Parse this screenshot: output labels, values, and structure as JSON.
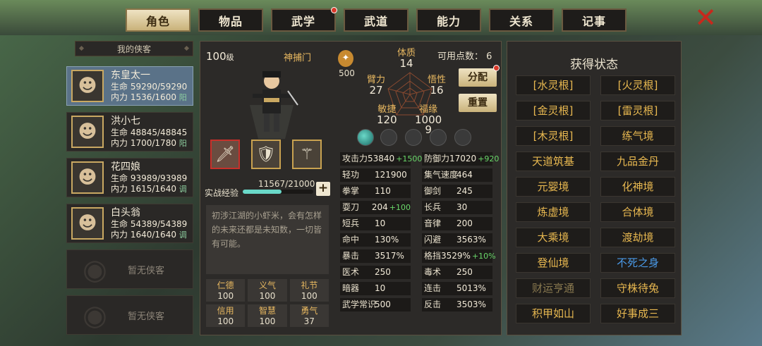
{
  "tabs": [
    {
      "label": "角色",
      "active": true
    },
    {
      "label": "物品"
    },
    {
      "label": "武学",
      "badge": true
    },
    {
      "label": "武道"
    },
    {
      "label": "能力"
    },
    {
      "label": "关系"
    },
    {
      "label": "记事"
    }
  ],
  "list": {
    "header": "我的侠客",
    "heroes": [
      {
        "name": "东皇太一",
        "hp_label": "生命",
        "hp": "59290/59290",
        "mp_label": "内力",
        "mp": "1536/1600",
        "tag": "阳",
        "selected": true
      },
      {
        "name": "洪小七",
        "hp_label": "生命",
        "hp": "48845/48845",
        "mp_label": "内力",
        "mp": "1700/1780",
        "tag": "阳"
      },
      {
        "name": "花四娘",
        "hp_label": "生命",
        "hp": "93989/93989",
        "mp_label": "内力",
        "mp": "1615/1640",
        "tag": "调"
      },
      {
        "name": "白头翁",
        "hp_label": "生命",
        "hp": "54389/54389",
        "mp_label": "内力",
        "mp": "1640/1640",
        "tag": "调"
      }
    ],
    "empty_label": "暂无侠客"
  },
  "char": {
    "level": "100",
    "level_unit": "级",
    "sect": "神捕门",
    "medal_value": "500",
    "exp_label": "实战经验",
    "exp_value": "11567/21000",
    "exp_fraction": 0.55,
    "bio": "初涉江湖的小虾米，会有怎样的未来还都是未知数，一切皆有可能。",
    "virtues": [
      {
        "l": "仁德",
        "v": "100"
      },
      {
        "l": "义气",
        "v": "100"
      },
      {
        "l": "礼节",
        "v": "100"
      },
      {
        "l": "信用",
        "v": "100"
      },
      {
        "l": "智慧",
        "v": "100"
      },
      {
        "l": "勇气",
        "v": "37"
      }
    ]
  },
  "radar": {
    "tizhi": {
      "l": "体质",
      "v": "14"
    },
    "bili": {
      "l": "臂力",
      "v": "27"
    },
    "wuxing": {
      "l": "悟性",
      "v": "16"
    },
    "minjie": {
      "l": "敏捷",
      "v": "120"
    },
    "fuyuan": {
      "l": "福缘",
      "v": "1000\n9"
    }
  },
  "points": {
    "label": "可用点数：",
    "value": "6",
    "assign": "分配",
    "reset": "重置"
  },
  "stats": [
    {
      "k": "攻击力",
      "v": "53840",
      "b": "+1500"
    },
    {
      "k": "防御力",
      "v": "17020",
      "b": "+920"
    },
    {
      "k": "轻功",
      "v": "121900"
    },
    {
      "k": "集气速度",
      "v": "464"
    },
    {
      "k": "拳掌",
      "v": "110"
    },
    {
      "k": "御剑",
      "v": "245"
    },
    {
      "k": "耍刀",
      "v": "204",
      "b": "+100"
    },
    {
      "k": "长兵",
      "v": "30"
    },
    {
      "k": "短兵",
      "v": "10"
    },
    {
      "k": "音律",
      "v": "200"
    },
    {
      "k": "命中",
      "v": "130%"
    },
    {
      "k": "闪避",
      "v": "3563%"
    },
    {
      "k": "暴击",
      "v": "3517%"
    },
    {
      "k": "格挡",
      "v": "3529%",
      "b": "+10%"
    },
    {
      "k": "医术",
      "v": "250"
    },
    {
      "k": "毒术",
      "v": "250"
    },
    {
      "k": "暗器",
      "v": "10"
    },
    {
      "k": "连击",
      "v": "5013%"
    },
    {
      "k": "武学常识",
      "v": "500"
    },
    {
      "k": "反击",
      "v": "3503%"
    }
  ],
  "status": {
    "title": "获得状态",
    "items": [
      {
        "t": "[水灵根]"
      },
      {
        "t": "[火灵根]"
      },
      {
        "t": "[金灵根]"
      },
      {
        "t": "[雷灵根]"
      },
      {
        "t": "[木灵根]"
      },
      {
        "t": "练气境"
      },
      {
        "t": "天道筑基"
      },
      {
        "t": "九品金丹"
      },
      {
        "t": "元婴境"
      },
      {
        "t": "化神境"
      },
      {
        "t": "炼虚境"
      },
      {
        "t": "合体境"
      },
      {
        "t": "大乘境"
      },
      {
        "t": "渡劫境"
      },
      {
        "t": "登仙境"
      },
      {
        "t": "不死之身",
        "c": "blue"
      },
      {
        "t": "财运亨通",
        "c": "dim"
      },
      {
        "t": "守株待兔"
      },
      {
        "t": "积甲如山"
      },
      {
        "t": "好事成三"
      }
    ]
  }
}
